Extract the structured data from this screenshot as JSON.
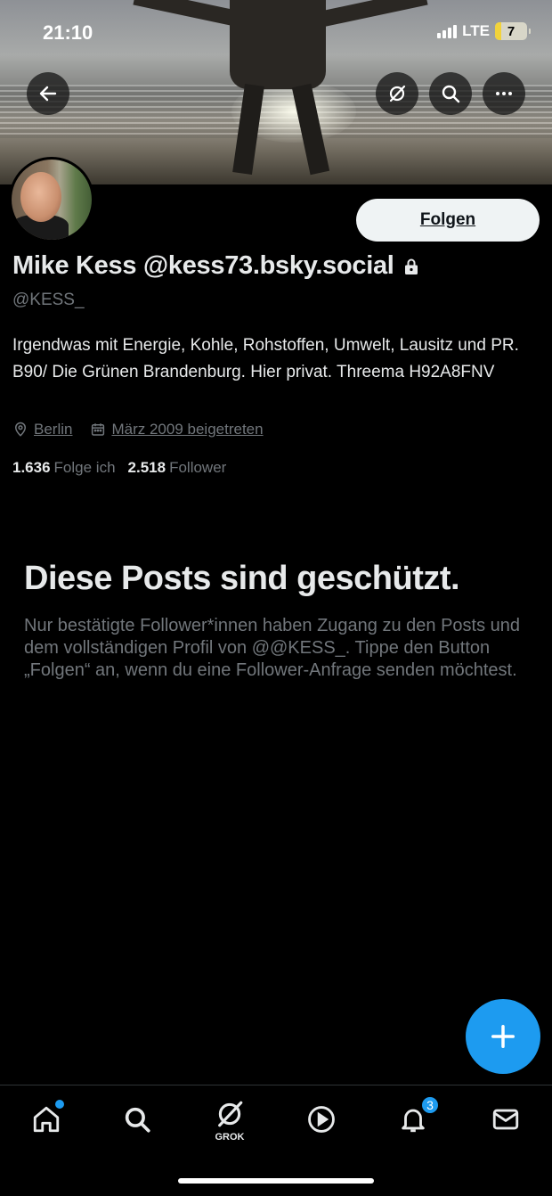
{
  "status_bar": {
    "time": "21:10",
    "network": "LTE",
    "battery": "7"
  },
  "profile": {
    "display_name": "Mike Kess @kess73.bsky.social",
    "handle": "@KESS_",
    "bio": "Irgendwas mit Energie, Kohle, Rohstoffen, Umwelt, Lausitz und PR. B90/ Die Grünen Brandenburg. Hier privat. Threema H92A8FNV",
    "location": "Berlin",
    "joined": "März 2009 beigetreten",
    "following_count": "1.636",
    "following_label": "Folge ich",
    "followers_count": "2.518",
    "followers_label": "Follower",
    "follow_button": "Folgen"
  },
  "protected": {
    "title": "Diese Posts sind geschützt.",
    "text": "Nur bestätigte Follower*innen haben Zugang zu den Posts und dem vollständigen Profil von @@KESS_. Tippe den Button „Folgen“ an, wenn du eine Follower-Anfrage senden möchtest."
  },
  "nav": {
    "grok_label": "GROK",
    "notifications_badge": "3"
  },
  "colors": {
    "accent": "#1d9bf0",
    "background": "#000000",
    "muted_text": "#71767b"
  }
}
